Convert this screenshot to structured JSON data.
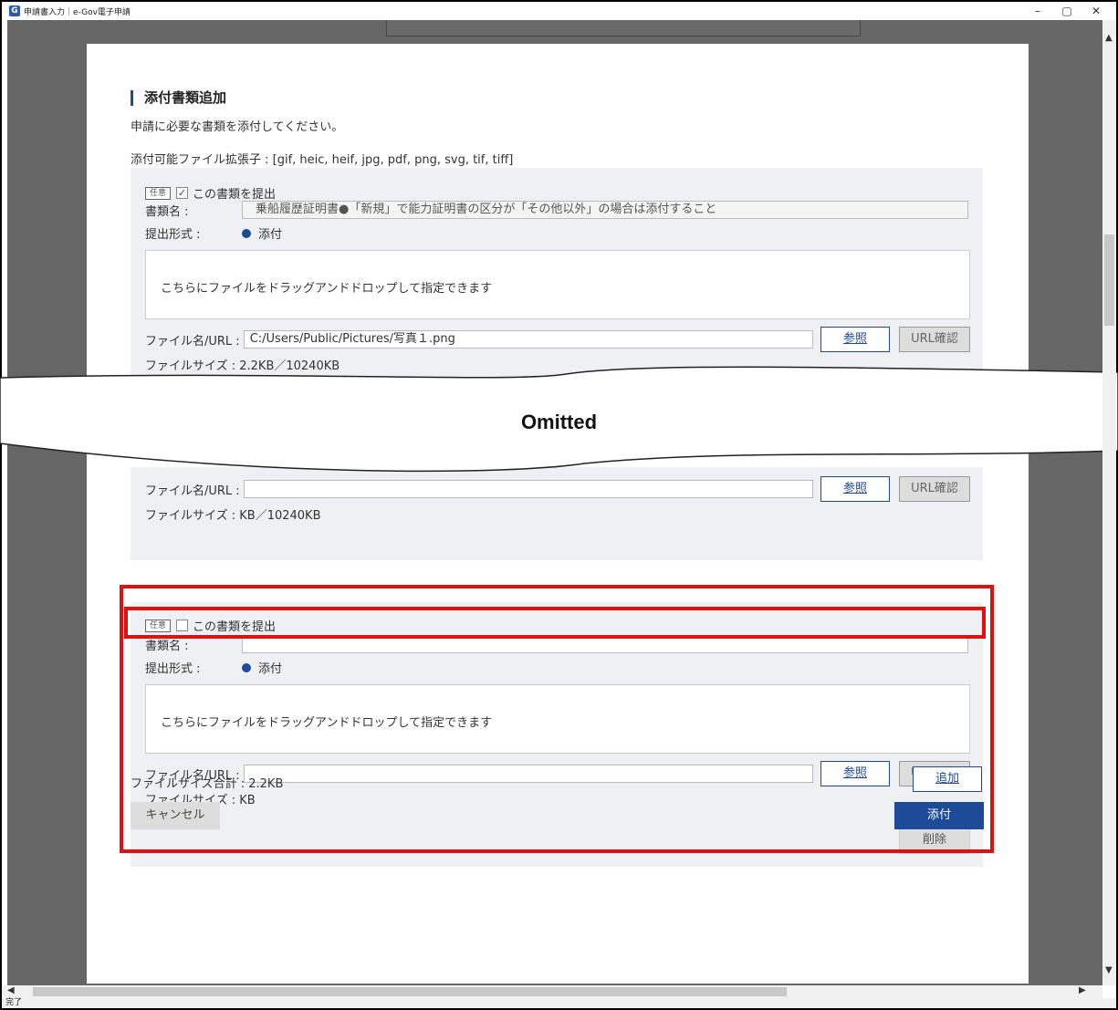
{
  "window": {
    "title": "申請書入力｜e-Gov電子申請",
    "icon": "G",
    "controls": [
      "–",
      "▢",
      "✕"
    ]
  },
  "section": {
    "title": "添付書類追加",
    "intro": "申請に必要な書類を添付してください。",
    "extensions": "添付可能ファイル拡張子 : [gif, heic, heif, jpg, pdf, png, svg, tif, tiff]"
  },
  "doc1": {
    "tag": "任意",
    "submit_label": "この書類を提出",
    "submit_checked": "✓",
    "name_label": "書類名 :",
    "name_value": "乗船履歴証明書●「新規」で能力証明書の区分が「その他以外」の場合は添付すること",
    "format_label": "提出形式 :",
    "format_value": "添付",
    "dropzone": "こちらにファイルをドラッグアンドドロップして指定できます",
    "url_label": "ファイル名/URL :",
    "url_value": "C:/Users/Public/Pictures/写真１.png",
    "browse": "参照",
    "url_check": "URL確認",
    "size": "ファイルサイズ : 2.2KB／10240KB"
  },
  "omitted": "Omitted",
  "doc2": {
    "url_label": "ファイル名/URL :",
    "url_value": "",
    "browse": "参照",
    "url_check": "URL確認",
    "size": "ファイルサイズ : KB／10240KB"
  },
  "doc3": {
    "tag": "任意",
    "submit_label": "この書類を提出",
    "name_label": "書類名 :",
    "name_value": "",
    "format_label": "提出形式 :",
    "format_value": "添付",
    "dropzone": "こちらにファイルをドラッグアンドドロップして指定できます",
    "url_label": "ファイル名/URL :",
    "url_value": "",
    "browse": "参照",
    "url_check": "URL確認",
    "size": "ファイルサイズ : KB",
    "delete": "削除"
  },
  "footer": {
    "total": "ファイルサイズ合計 : 2.2KB",
    "add": "追加",
    "cancel": "キャンセル",
    "attach": "添付"
  },
  "status_bar": "完了",
  "colors": {
    "accent": "#1e4a9a",
    "highlight": "#e01010",
    "doc_bg": "#eef0f4"
  }
}
